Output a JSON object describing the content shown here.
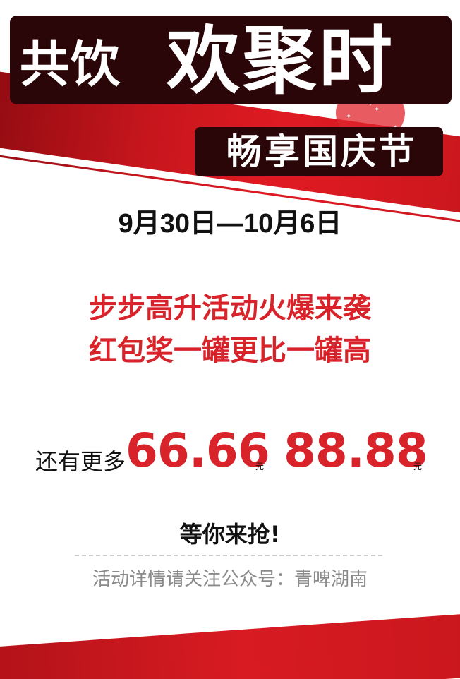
{
  "headline": {
    "small": "共饮",
    "big": "欢聚时"
  },
  "subheadline": "畅享国庆节",
  "date_range": "9月30日—10月6日",
  "promo_lines": [
    "步步高升活动火爆来袭",
    "红包奖一罐更比一罐高"
  ],
  "amounts": {
    "prefix": "还有更多",
    "values": [
      "66.66",
      "88.88"
    ],
    "unit": "元"
  },
  "call_to_action": "等你来抢!",
  "footnote": "活动详情请关注公众号：青啤湖南",
  "colors": {
    "accent_red": "#d8232a",
    "band_red": "#c8161d",
    "outline_dark": "#2a0608"
  },
  "icons": [
    "heart-decoration-icon",
    "sparkle-icon"
  ]
}
